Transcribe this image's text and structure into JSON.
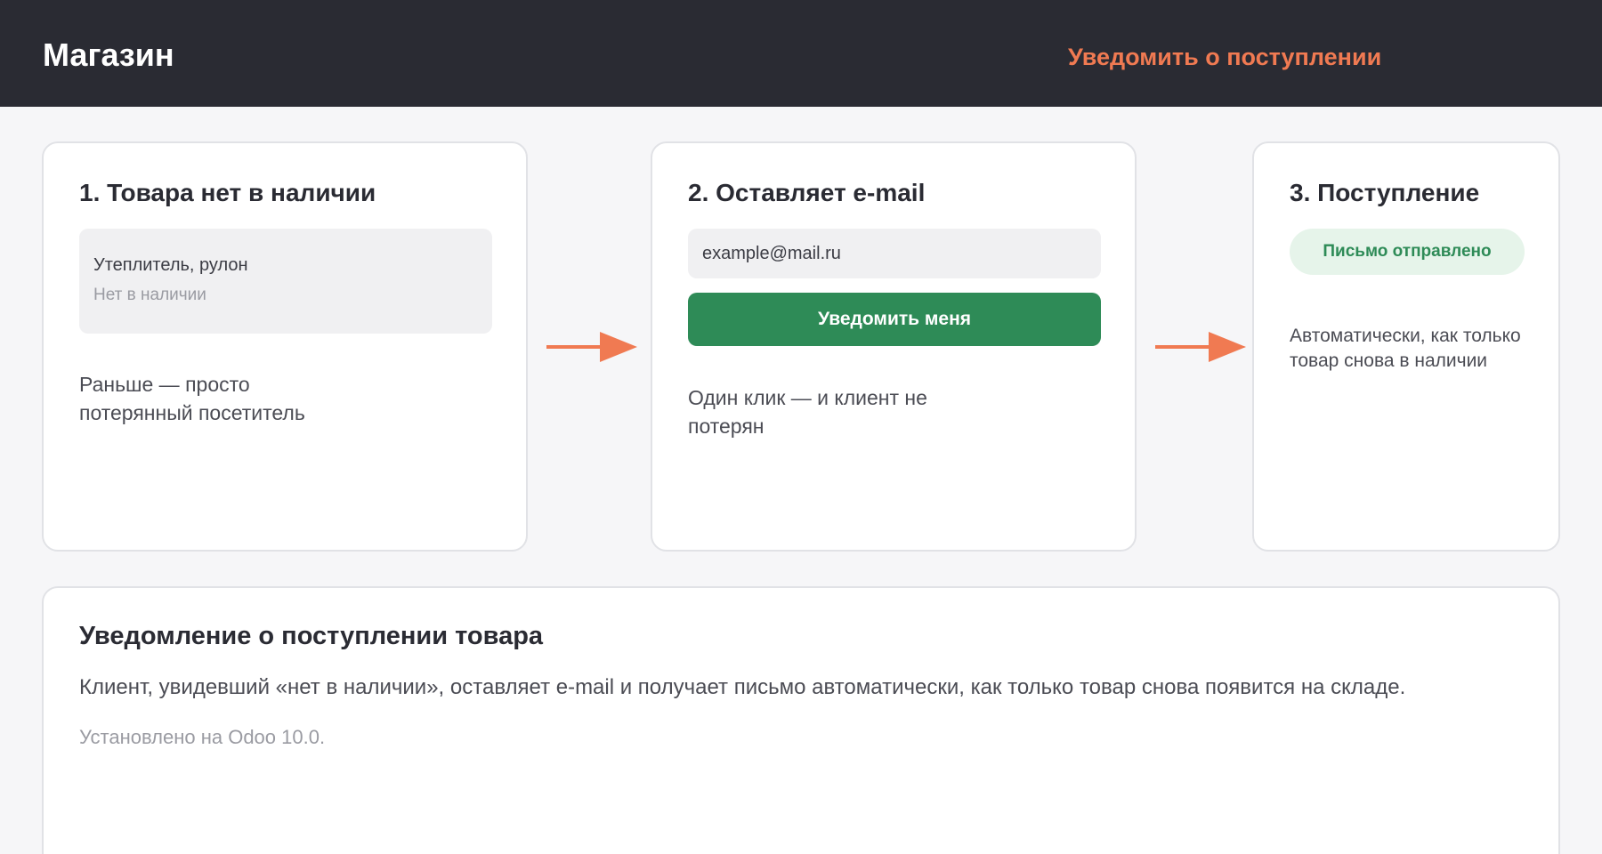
{
  "header": {
    "brand": "Магазин",
    "link_label": "Уведомить о поступлении"
  },
  "steps": [
    {
      "title": "1. Товара нет в наличии",
      "product_name": "Утеплитель, рулон",
      "product_status": "Нет в наличии",
      "note": "Раньше — просто потерянный посетитель"
    },
    {
      "title": "2. Оставляет e-mail",
      "email_value": "example@mail.ru",
      "button_label": "Уведомить меня",
      "note": "Один клик — и клиент не потерян"
    },
    {
      "title": "3. Поступление",
      "badge_label": "Письмо отправлено",
      "note": "Автоматически, как только товар снова в наличии"
    }
  ],
  "info": {
    "title": "Уведомление о поступлении товара",
    "text": "Клиент, увидевший «нет в наличии», оставляет e-mail и получает письмо автоматически, как только товар снова появится на складе.",
    "footnote": "Установлено на Odoo 10.0."
  },
  "colors": {
    "header_bg": "#2a2b33",
    "accent": "#f07a52",
    "button_green": "#2e8b57",
    "badge_bg": "#e6f4ea"
  },
  "icons": [
    "arrow-right-icon"
  ]
}
